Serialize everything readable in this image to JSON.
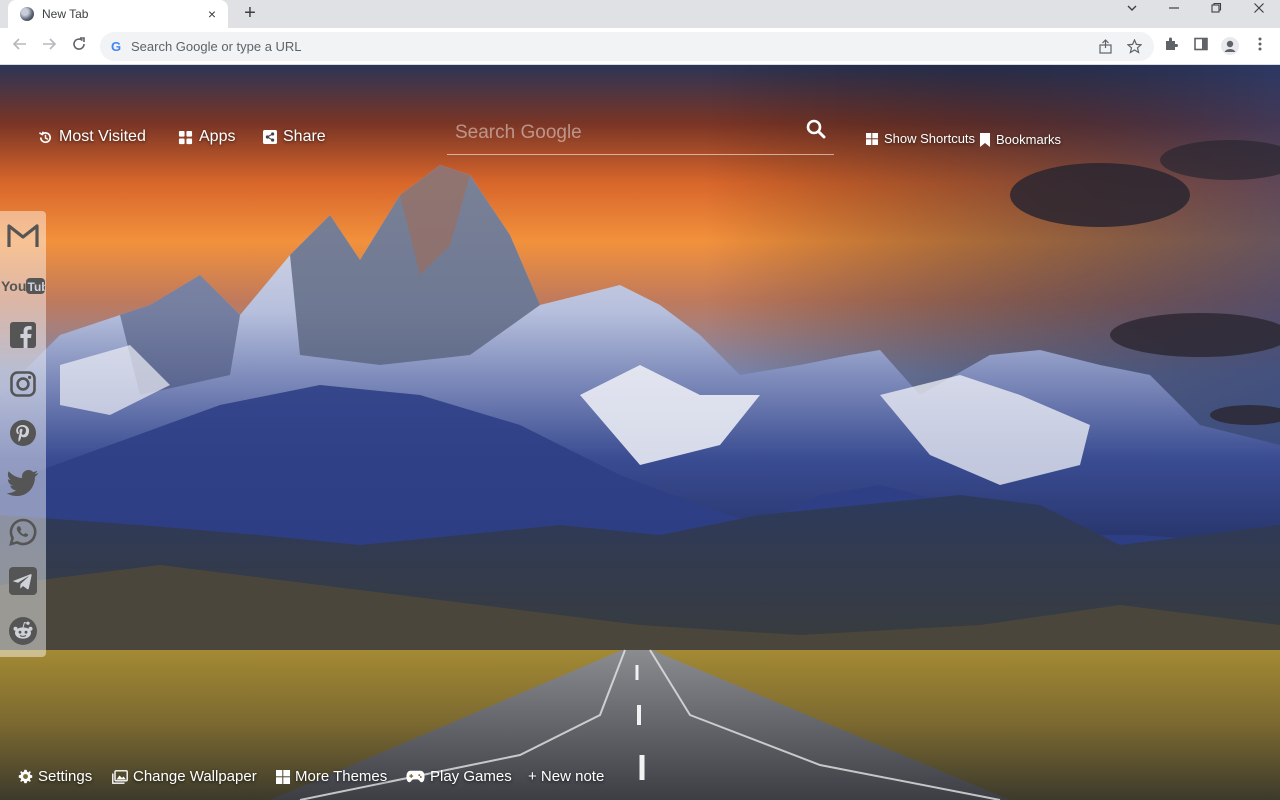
{
  "browser": {
    "tab_title": "New Tab",
    "tab_close": "×",
    "new_tab": "+",
    "omnibox_placeholder": "Search Google or type a URL",
    "google_letter": "G"
  },
  "page": {
    "top_left": {
      "most_visited": "Most Visited",
      "apps": "Apps",
      "share": "Share"
    },
    "search": {
      "placeholder": "Search Google"
    },
    "top_right": {
      "show_shortcuts": "Show Shortcuts",
      "bookmarks": "Bookmarks"
    },
    "social": [
      "gmail-icon",
      "youtube-icon",
      "facebook-icon",
      "instagram-icon",
      "pinterest-icon",
      "twitter-icon",
      "whatsapp-icon",
      "telegram-icon",
      "reddit-icon"
    ],
    "bottom": {
      "settings": "Settings",
      "change_wallpaper": "Change Wallpaper",
      "more_themes": "More Themes",
      "play_games": "Play Games",
      "new_note": "+ New note"
    }
  },
  "colors": {
    "accent": "#ffffff",
    "omnibox_bg": "#f1f3f4",
    "tabstrip_bg": "#dfe1e5"
  }
}
